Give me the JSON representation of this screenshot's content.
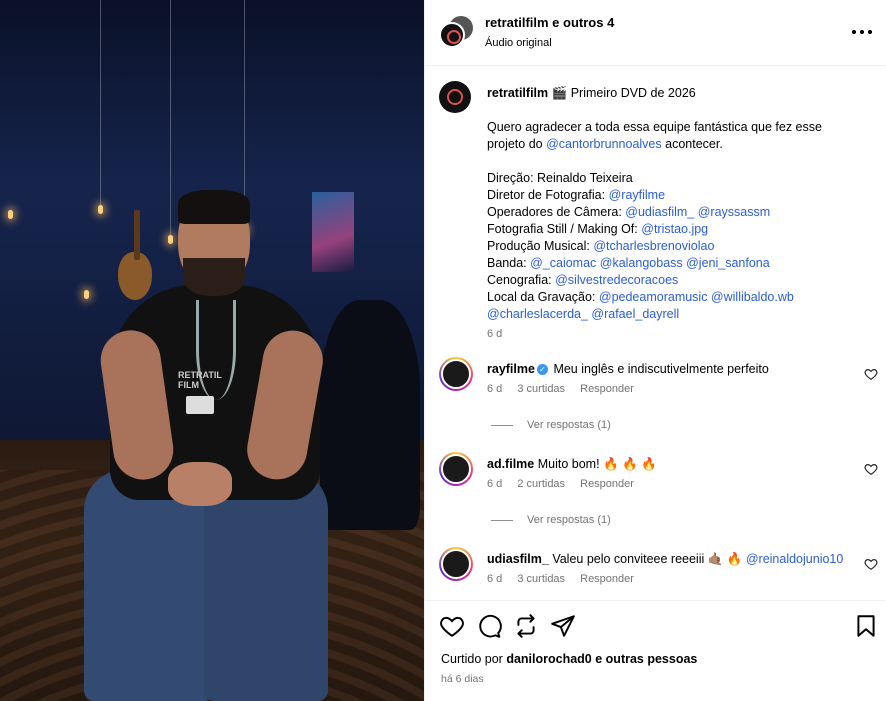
{
  "post_header": {
    "title": "retratilfilm e outros 4",
    "audio": "Áudio original",
    "more_icon": "more-horizontal-icon"
  },
  "caption": {
    "username": "retratilfilm",
    "emoji": "🎬",
    "title": "Primeiro DVD de 2026",
    "thanks_line1": "Quero agradecer a toda essa equipe fantástica que fez esse",
    "thanks_pre": "projeto do",
    "thanks_mention": "@cantorbrunnoalves",
    "thanks_post": "acontecer.",
    "direction": "Direção: Reinaldo Teixeira",
    "photo_dir_label": "Diretor de Fotografia:",
    "photo_dir_mention": "@rayfilme",
    "camera_label": "Operadores de Câmera:",
    "camera_mentions": "@udiasfilm_ @rayssassm",
    "still_label": "Fotografia Still / Making Of:",
    "still_mention": "@tristao.jpg",
    "music_label": "Produção Musical:",
    "music_mention": "@tcharlesbrenoviolao",
    "band_label": "Banda:",
    "band_mentions": "@_caiomac @kalangobass @jeni_sanfona",
    "set_label": "Cenografia:",
    "set_mention": "@silvestredecoracoes",
    "location_label": "Local da Gravação:",
    "location_mentions": "@pedeamoramusic @willibaldo.wb",
    "location_mentions2": "@charleslacerda_ @rafael_dayrell",
    "time": "6 d"
  },
  "comments": [
    {
      "username": "rayfilme",
      "verified": true,
      "text": "Meu inglês e indiscutivelmente perfeito",
      "time": "6 d",
      "likes": "3 curtidas",
      "reply": "Responder",
      "replies": "Ver respostas (1)"
    },
    {
      "username": "ad.filme",
      "text": "Muito bom!",
      "emoji": "🔥 🔥 🔥",
      "time": "6 d",
      "likes": "2 curtidas",
      "reply": "Responder",
      "replies": "Ver respostas (1)"
    },
    {
      "username": "udiasfilm_",
      "text": "Valeu pelo conviteee reeeiii",
      "emoji": "🤙🏽 🔥",
      "mention": "@reinaldojunio10",
      "time": "6 d",
      "likes": "3 curtidas",
      "reply": "Responder"
    }
  ],
  "actions": {
    "icons": [
      "heart-icon",
      "comment-icon",
      "repost-icon",
      "share-icon",
      "bookmark-icon"
    ],
    "liked_prefix": "Curtido por",
    "liked_user": "danilorochad0",
    "liked_suffix": "e outras pessoas",
    "when": "há 6 dias"
  },
  "image": {
    "badge_text": "RETRATIL FILM"
  }
}
